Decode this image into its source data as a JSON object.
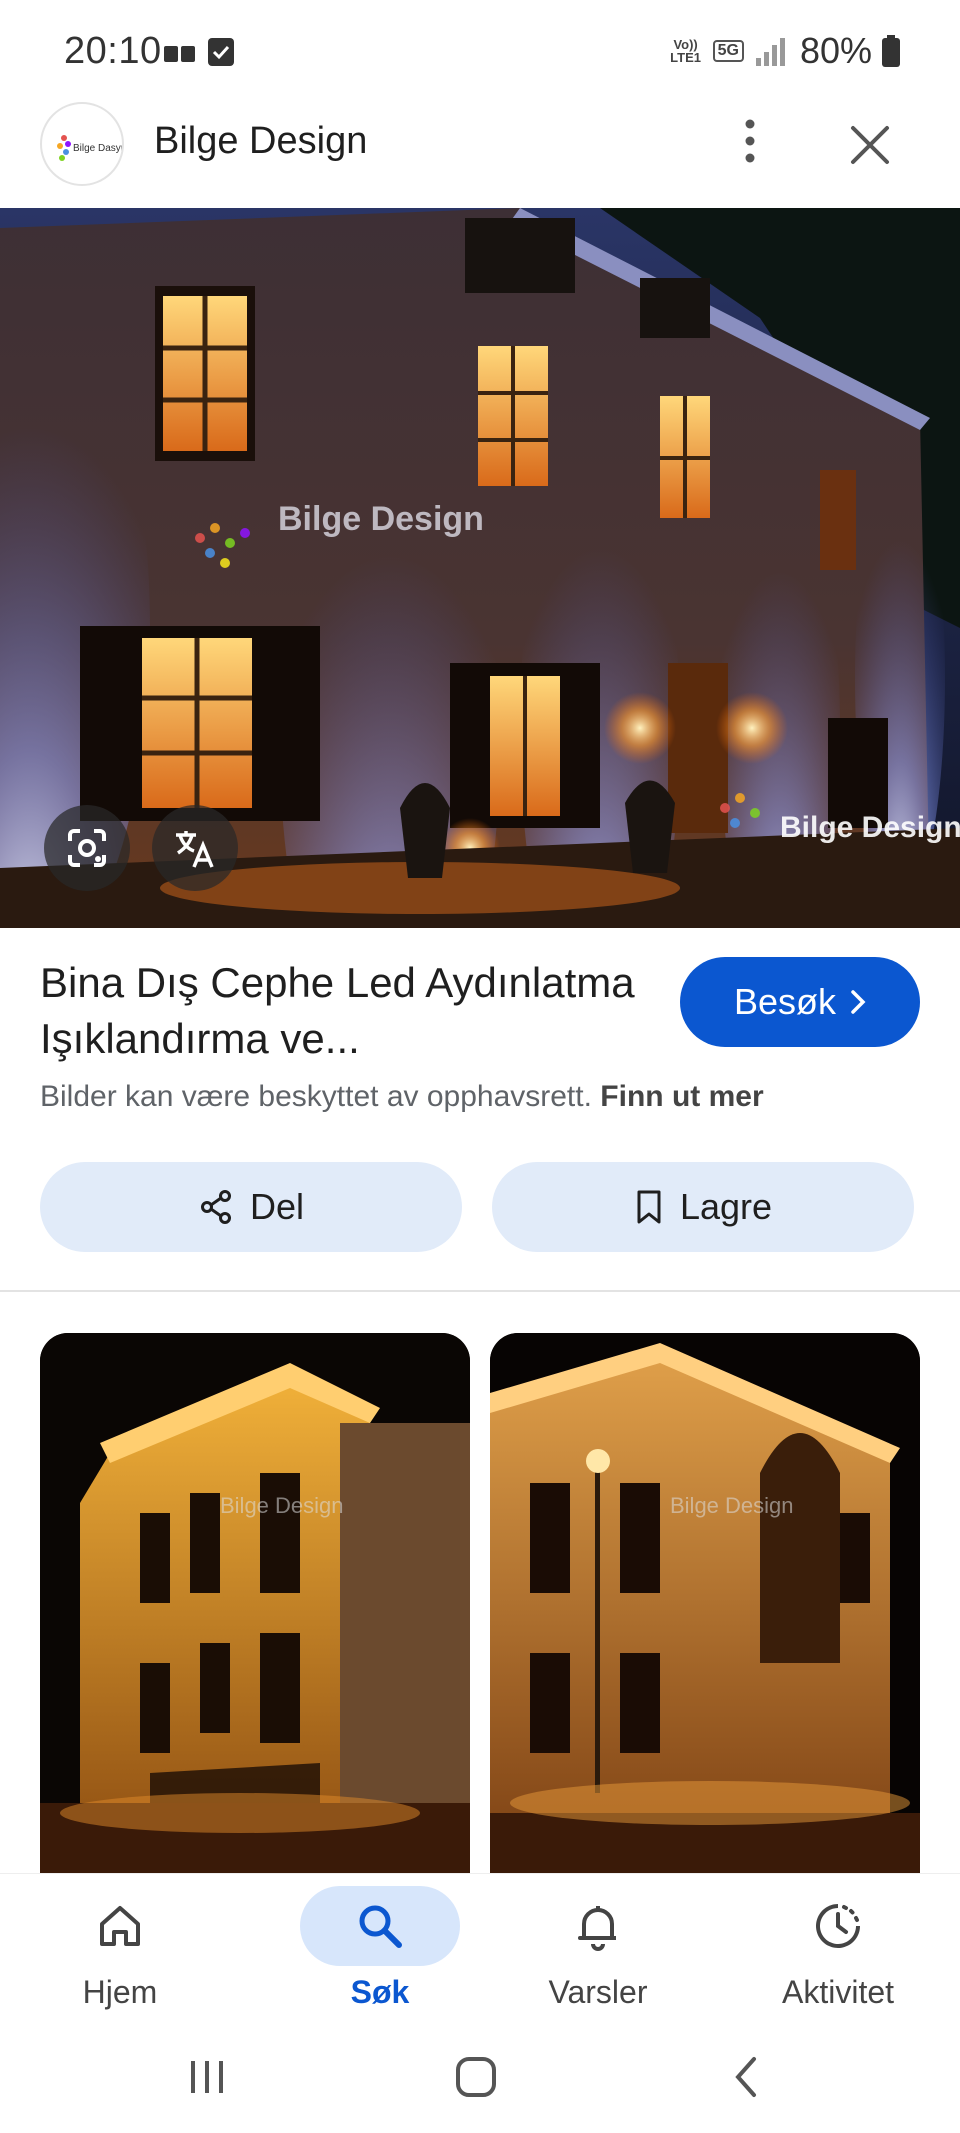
{
  "status_bar": {
    "time": "20:10",
    "network_volte": "Vo)) LTE1",
    "network_type": "5G",
    "battery": "80%"
  },
  "header": {
    "site_name": "Bilge Design",
    "logo_text": "Bilge Design",
    "more_icon": "more-vertical-icon",
    "close_icon": "close-icon"
  },
  "hero": {
    "watermark_1": "Bilge Design",
    "watermark_2": "Bilge Design",
    "lens_icon": "google-lens-icon",
    "translate_icon": "translate-icon"
  },
  "result": {
    "title": "Bina Dış Cephe Led Aydınlatma Işıklandırma ve...",
    "visit_label": "Besøk",
    "copyright_text": "Bilder kan være beskyttet av opphavsrett.",
    "learn_more": "Finn ut mer",
    "share_label": "Del",
    "save_label": "Lagre"
  },
  "related": [
    {
      "watermark": "Bilge Design"
    },
    {
      "watermark": "Bilge Design"
    }
  ],
  "bottom_nav": [
    {
      "label": "Hjem",
      "icon": "home-icon",
      "active": false
    },
    {
      "label": "Søk",
      "icon": "search-icon",
      "active": true
    },
    {
      "label": "Varsler",
      "icon": "bell-icon",
      "active": false
    },
    {
      "label": "Aktivitet",
      "icon": "activity-icon",
      "active": false
    }
  ],
  "colors": {
    "accent": "#0b57d0",
    "pill": "#e1ebf9",
    "nav_active_pill": "#d7e6fb"
  }
}
